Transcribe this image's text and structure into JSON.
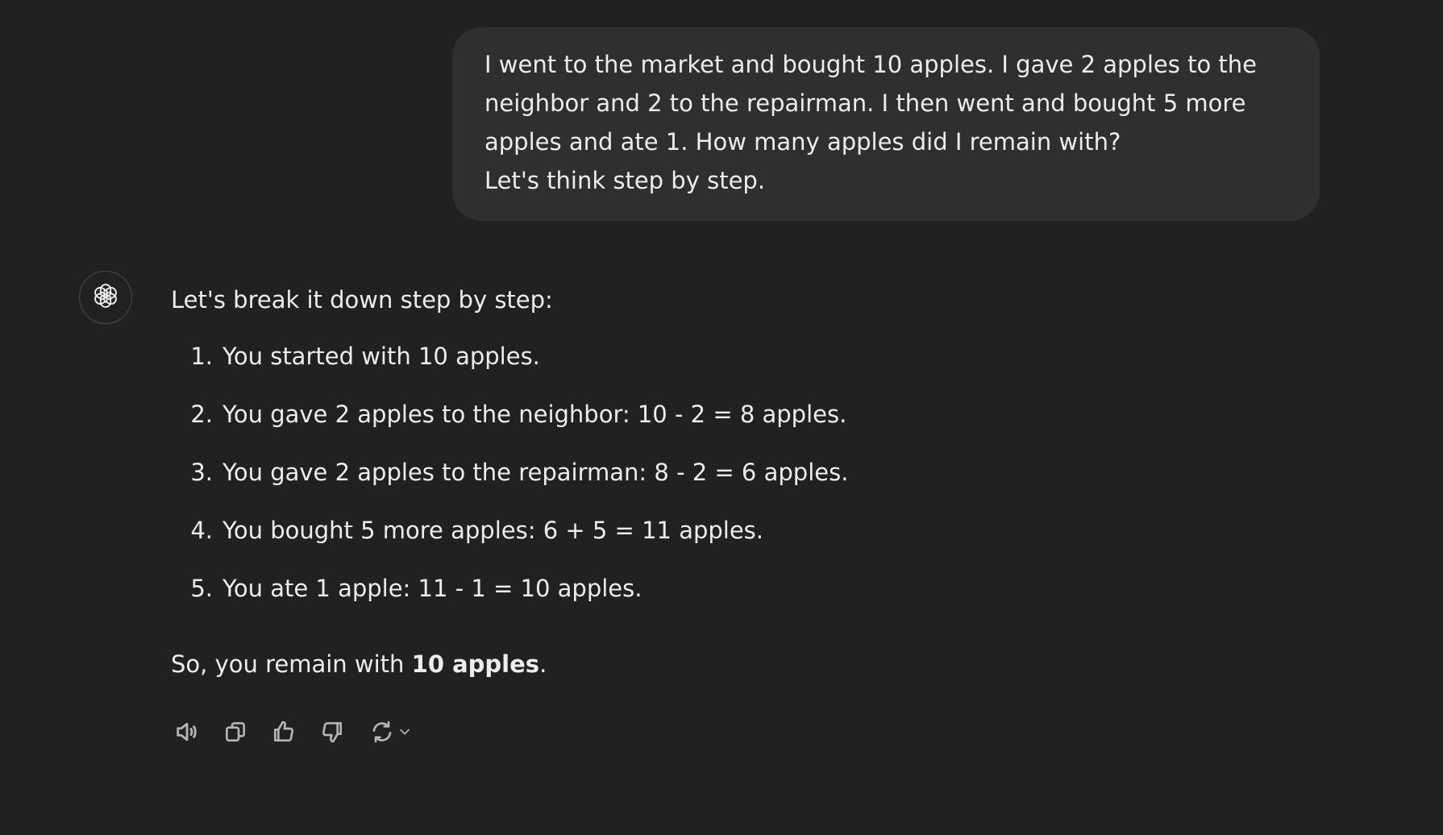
{
  "user_message": {
    "lines": [
      "I went to the market and bought 10 apples. I gave 2 apples to the",
      "neighbor and 2 to the repairman. I then went and bought 5 more",
      "apples and ate 1. How many apples did I remain with?",
      "Let's think step by step."
    ]
  },
  "assistant": {
    "avatar_icon": "openai-logo-icon",
    "intro": "Let's break it down step by step:",
    "steps": [
      {
        "num": "1.",
        "text": "You started with 10 apples."
      },
      {
        "num": "2.",
        "text": "You gave 2 apples to the neighbor: 10 - 2 = 8 apples."
      },
      {
        "num": "3.",
        "text": "You gave 2 apples to the repairman: 8 - 2 = 6 apples."
      },
      {
        "num": "4.",
        "text": "You bought 5 more apples: 6 + 5 = 11 apples."
      },
      {
        "num": "5.",
        "text": "You ate 1 apple: 11 - 1 = 10 apples."
      }
    ],
    "conclusion_prefix": "So, you remain with ",
    "conclusion_bold": "10 apples",
    "conclusion_suffix": "."
  },
  "actions": {
    "icons": [
      "read-aloud-icon",
      "copy-icon",
      "thumbs-up-icon",
      "thumbs-down-icon",
      "regenerate-icon",
      "chevron-down-icon"
    ]
  },
  "colors": {
    "background": "#212121",
    "bubble": "#2f2f2f",
    "text": "#ececec",
    "icon": "#b4b4b4"
  }
}
